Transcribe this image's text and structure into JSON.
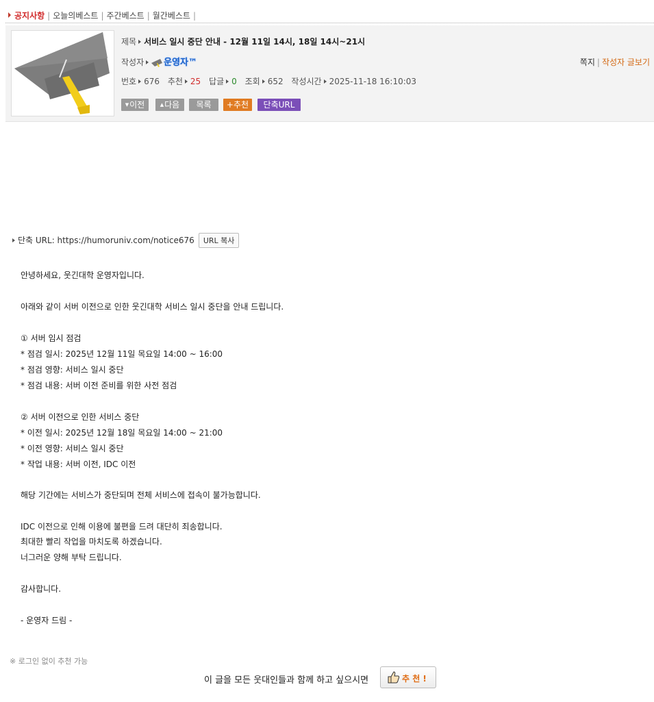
{
  "tabs": {
    "items": [
      "공지사항",
      "오늘의베스트",
      "주간베스트",
      "월간베스트"
    ]
  },
  "post": {
    "title_label": "제목",
    "title": "서비스 일시 중단 안내 - 12월 11일 14시, 18일 14시~21시",
    "author_label": "작성자",
    "author": "운영자™",
    "message_link": "쪽지",
    "author_posts_link": "작성자 글보기",
    "number_label": "번호",
    "number": "676",
    "recommend_label": "추천",
    "recommend": "25",
    "replies_label": "답글",
    "replies": "0",
    "views_label": "조회",
    "views": "652",
    "date_label": "작성시간",
    "date": "2025-11-18 16:10:03"
  },
  "buttons": {
    "prev": "이전",
    "next": "다음",
    "list": "목록",
    "recommend": "+추천",
    "short_url": "단축URL"
  },
  "short_url": {
    "label": "단축 URL: https://humoruniv.com/notice676",
    "copy": "URL 복사"
  },
  "content": {
    "lines": [
      "안녕하세요, 웃긴대학 운영자입니다.",
      "아래와 같이 서버 이전으로 인한 웃긴대학 서비스 일시 중단을 안내 드립니다.",
      "① 서버 임시 점검",
      "* 점검 일시: 2025년 12월 11일 목요일 14:00 ~ 16:00",
      "* 점검 영향: 서비스 일시 중단",
      "* 점검 내용: 서버 이전 준비를 위한 사전 점검",
      "② 서버 이전으로 인한 서비스 중단",
      "* 이전 일시: 2025년 12월 18일 목요일 14:00 ~ 21:00",
      "* 이전 영향: 서비스 일시 중단",
      "* 작업 내용: 서버 이전, IDC 이전",
      "해당 기간에는 서비스가 중단되며 전체 서비스에 접속이 불가능합니다.",
      "IDC 이전으로 인해 이용에 불편을 드려 대단히 죄송합니다.",
      "최대한 빨리 작업을 마치도록 하겠습니다.",
      "너그러운 양해 부탁 드립니다.",
      "감사합니다.",
      "- 운영자 드림 -"
    ]
  },
  "footer": {
    "login_note": "※ 로그인 없이 추천 가능",
    "share_text": "이 글을 모든 웃대인들과 함께 하고 싶으시면",
    "recommend_button": "추 천 !"
  },
  "colors": {
    "active_tab": "#d12c2c",
    "recommend_count": "#d12c2c",
    "reply_count": "#2b8a2b",
    "author_posts": "#d46a16",
    "btn_orange": "#e07b22",
    "btn_purple": "#7b4fb8",
    "btn_gray": "#9a9a9a"
  },
  "icons": [
    "graduation-cap-icon",
    "triangle-arrow-icon",
    "thumbs-up-icon"
  ]
}
